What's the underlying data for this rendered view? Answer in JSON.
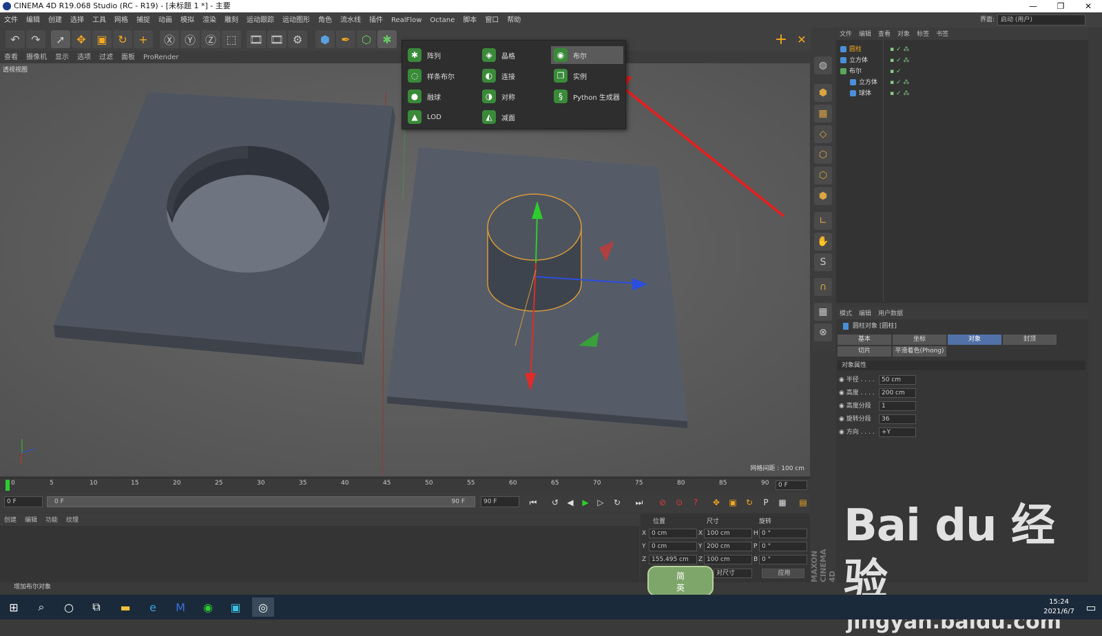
{
  "window": {
    "title": "CINEMA 4D R19.068 Studio (RC - R19) - [未标题 1 *] - 主要",
    "min": "—",
    "max": "❐",
    "close": "✕"
  },
  "menu": [
    "文件",
    "编辑",
    "创建",
    "选择",
    "工具",
    "网格",
    "捕捉",
    "动画",
    "模拟",
    "渲染",
    "雕刻",
    "运动跟踪",
    "运动图形",
    "角色",
    "流水线",
    "插件",
    "RealFlow",
    "Octane",
    "脚本",
    "窗口",
    "帮助"
  ],
  "layout": {
    "label": "界面:",
    "value": "启动 (用户)"
  },
  "viewmenu": [
    "查看",
    "摄像机",
    "显示",
    "选项",
    "过滤",
    "面板",
    "ProRender"
  ],
  "viewport": {
    "label": "透视视图",
    "grid": "网格间距 : 100 cm"
  },
  "popup": {
    "col1": [
      "阵列",
      "样条布尔",
      "融球",
      "LOD"
    ],
    "col2": [
      "晶格",
      "连接",
      "对称",
      "减面"
    ],
    "col3": [
      "布尔",
      "实例",
      "Python 生成器"
    ]
  },
  "objmgr": {
    "menu": [
      "文件",
      "编辑",
      "查看",
      "对象",
      "标签",
      "书签"
    ],
    "rows": [
      "圆柱",
      "立方体",
      "布尔",
      "立方体",
      "球体"
    ]
  },
  "attr": {
    "menu": [
      "模式",
      "编辑",
      "用户数据"
    ],
    "object": "圆柱对象 [圆柱]",
    "tabs": [
      "基本",
      "坐标",
      "对象",
      "封顶",
      "切片",
      "平滑着色(Phong)"
    ],
    "section": "对象属性",
    "props": [
      {
        "label": "半径 . . . .",
        "value": "50 cm"
      },
      {
        "label": "高度 . . . .",
        "value": "200 cm"
      },
      {
        "label": "高度分段",
        "value": "1"
      },
      {
        "label": "旋转分段",
        "value": "36"
      },
      {
        "label": "方向 . . . .",
        "value": "+Y"
      }
    ]
  },
  "timeline": {
    "ticks": [
      "0",
      "5",
      "10",
      "15",
      "20",
      "25",
      "30",
      "35",
      "40",
      "45",
      "50",
      "55",
      "60",
      "65",
      "70",
      "75",
      "80",
      "85",
      "90"
    ],
    "frame": "0 F",
    "start": "0 F",
    "range_start": "0 F",
    "range_end": "90 F",
    "end": "90 F"
  },
  "matmgr": {
    "menu": [
      "创建",
      "编辑",
      "功能",
      "纹理"
    ]
  },
  "coords": {
    "headers": [
      "位置",
      "尺寸",
      "旋转"
    ],
    "rows": [
      {
        "axis": "X",
        "pos": "0 cm",
        "size": "100 cm",
        "rlabel": "H",
        "rot": "0 °"
      },
      {
        "axis": "Y",
        "pos": "0 cm",
        "size": "200 cm",
        "rlabel": "P",
        "rot": "0 °"
      },
      {
        "axis": "Z",
        "pos": "155.495 cm",
        "size": "100 cm",
        "rlabel": "B",
        "rot": "0 °"
      }
    ],
    "mode": "对尺寸",
    "apply": "应用"
  },
  "status": "增加布尔对象",
  "maxon": "MAXON CINEMA 4D",
  "watermark": {
    "logo": "Bai du 经验",
    "url": "jingyan.baidu.com"
  },
  "ime": {
    "line1": "简",
    "line2": "英"
  },
  "clock": {
    "time": "15:24",
    "date": "2021/6/7"
  },
  "colors": {
    "accent": "#5271a8",
    "arrow": "#e02020",
    "viewport": "#5f5f5f"
  }
}
